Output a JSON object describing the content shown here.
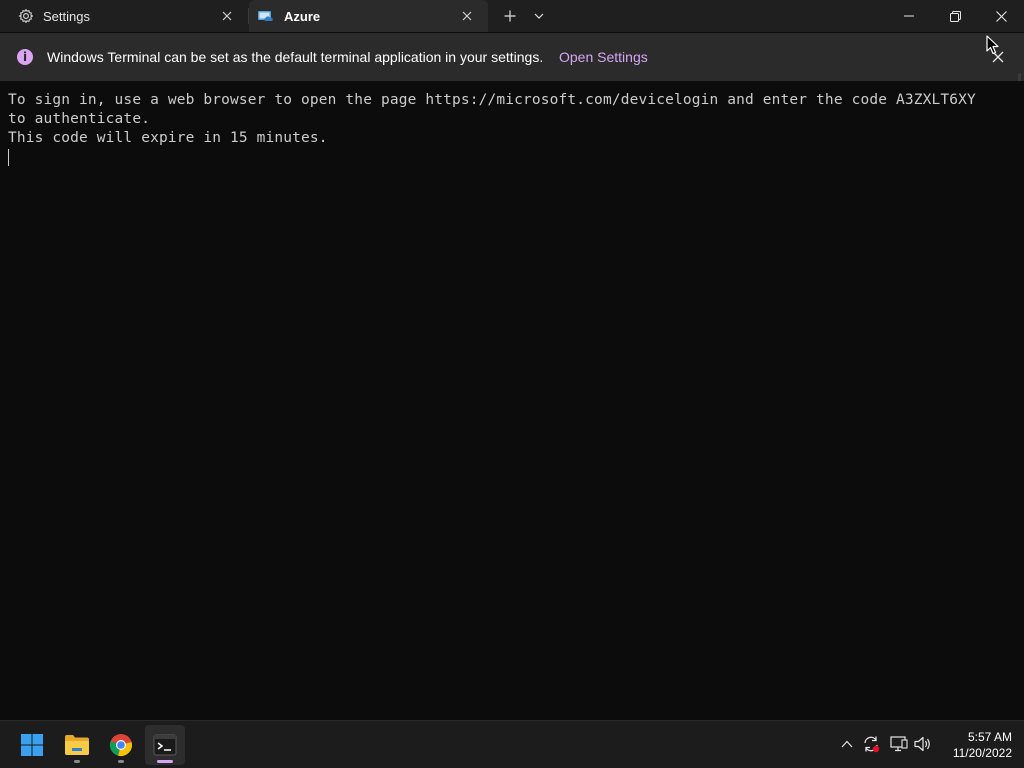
{
  "window": {
    "tabs": [
      {
        "title": "Settings",
        "icon": "gear-icon",
        "active": false
      },
      {
        "title": "Azure",
        "icon": "azure-cloud-icon",
        "active": true
      }
    ],
    "new_tab_icon": "plus-icon",
    "dropdown_icon": "chevron-down-icon",
    "controls": [
      "minimize-icon",
      "restore-icon",
      "close-icon"
    ]
  },
  "infobar": {
    "message": "Windows Terminal can be set as the default terminal application in your settings.",
    "link": "Open Settings",
    "icon_color": "#d9a4f0",
    "link_color": "#d6a6f2"
  },
  "terminal": {
    "lines": [
      "To sign in, use a web browser to open the page https://microsoft.com/devicelogin and enter the code A3ZXLT6XY",
      "to authenticate.",
      "This code will expire in 15 minutes."
    ],
    "foreground": "#cccccc",
    "background": "#0c0c0c"
  },
  "taskbar": {
    "apps": [
      "windows-start-icon",
      "file-explorer-icon",
      "chrome-icon",
      "terminal-icon"
    ],
    "tray": [
      "chevron-up-icon",
      "sync-icon",
      "network-icon",
      "volume-icon"
    ],
    "time": "5:57 AM",
    "date": "11/20/2022"
  }
}
